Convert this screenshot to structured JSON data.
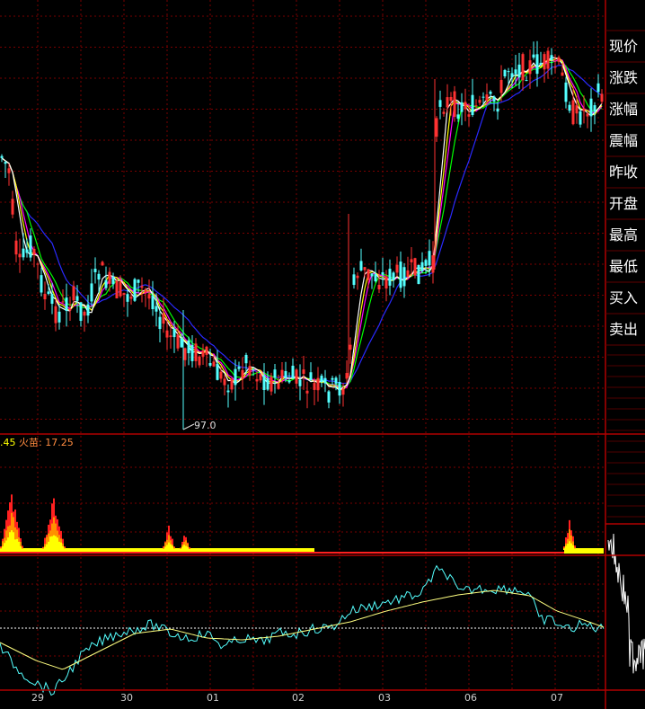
{
  "side_panel": {
    "labels": [
      "现价",
      "涨跌",
      "涨幅",
      "震幅",
      "昨收",
      "开盘",
      "最高",
      "最低",
      "买入",
      "卖出"
    ]
  },
  "price_panel": {
    "low_marker": "97.0"
  },
  "indicator_panel": {
    "value_prefix": ".45",
    "name": "火苗",
    "value": "17.25"
  },
  "chart_data": [
    {
      "type": "candlestick",
      "categories": [
        "29",
        "30",
        "01",
        "02",
        "03",
        "06",
        "07"
      ],
      "title": "",
      "xlabel": "",
      "ylabel": "",
      "annotations": [
        "97.0"
      ],
      "colors": {
        "up": "#ff3232",
        "down": "#54ffff",
        "ma5": "#ffffff",
        "ma10": "#ffff00",
        "ma20": "#ff00ff",
        "ma30": "#00ff00",
        "ma60": "#2a2aff"
      },
      "grid": true
    },
    {
      "type": "bar",
      "series": [
        {
          "name": "火苗",
          "value": 17.25
        }
      ],
      "colors": {
        "high": "#ff2020",
        "mid": "#ff9000",
        "low": "#ffff00"
      }
    },
    {
      "type": "line",
      "series": [
        {
          "name": "",
          "color": "#54ffff"
        },
        {
          "name": "",
          "color": "#ffff80"
        }
      ]
    }
  ]
}
